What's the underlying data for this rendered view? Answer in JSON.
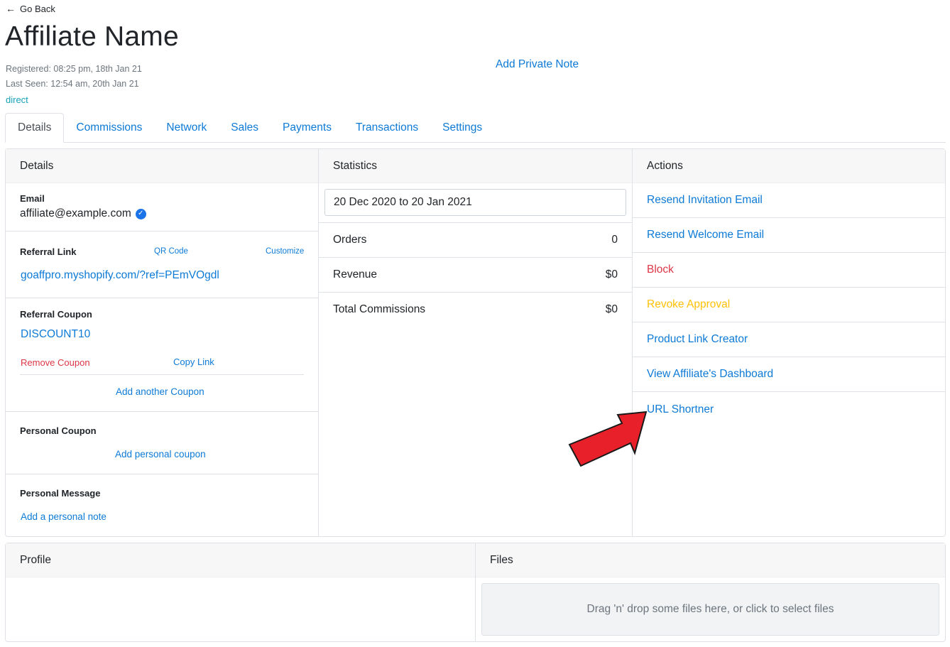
{
  "header": {
    "go_back": "Go Back",
    "title": "Affiliate Name",
    "registered": "Registered: 08:25 pm, 18th Jan 21",
    "last_seen": "Last Seen: 12:54 am, 20th Jan 21",
    "source": "direct",
    "private_note": "Add Private Note"
  },
  "tabs": [
    {
      "label": "Details"
    },
    {
      "label": "Commissions"
    },
    {
      "label": "Network"
    },
    {
      "label": "Sales"
    },
    {
      "label": "Payments"
    },
    {
      "label": "Transactions"
    },
    {
      "label": "Settings"
    }
  ],
  "details": {
    "header": "Details",
    "email_label": "Email",
    "email_value": "affiliate@example.com",
    "referral_link_label": "Referral Link",
    "qr_code": "QR Code",
    "customize": "Customize",
    "referral_link_value": "goaffpro.myshopify.com/?ref=PEmVOgdl",
    "referral_coupon_label": "Referral Coupon",
    "coupon_code": "DISCOUNT10",
    "remove_coupon": "Remove Coupon",
    "copy_link": "Copy Link",
    "add_another_coupon": "Add another Coupon",
    "personal_coupon_label": "Personal Coupon",
    "add_personal_coupon": "Add personal coupon",
    "personal_message_label": "Personal Message",
    "add_personal_note": "Add a personal note"
  },
  "statistics": {
    "header": "Statistics",
    "date_range": "20 Dec 2020 to 20 Jan 2021",
    "rows": [
      {
        "label": "Orders",
        "value": "0"
      },
      {
        "label": "Revenue",
        "value": "$0"
      },
      {
        "label": "Total Commissions",
        "value": "$0"
      }
    ]
  },
  "actions": {
    "header": "Actions",
    "items": [
      {
        "label": "Resend Invitation Email",
        "style": "link"
      },
      {
        "label": "Resend Welcome Email",
        "style": "link"
      },
      {
        "label": "Block",
        "style": "danger"
      },
      {
        "label": "Revoke Approval",
        "style": "warning"
      },
      {
        "label": "Product Link Creator",
        "style": "link"
      },
      {
        "label": "View Affiliate's Dashboard",
        "style": "link"
      },
      {
        "label": "URL Shortner",
        "style": "link"
      }
    ]
  },
  "profile": {
    "header": "Profile"
  },
  "files": {
    "header": "Files",
    "dropzone_text": "Drag 'n' drop some files here, or click to select files"
  },
  "colors": {
    "link": "#0d7ad6",
    "danger": "#dc3545",
    "warning": "#ffc107",
    "annotation_arrow": "#e8202a"
  }
}
